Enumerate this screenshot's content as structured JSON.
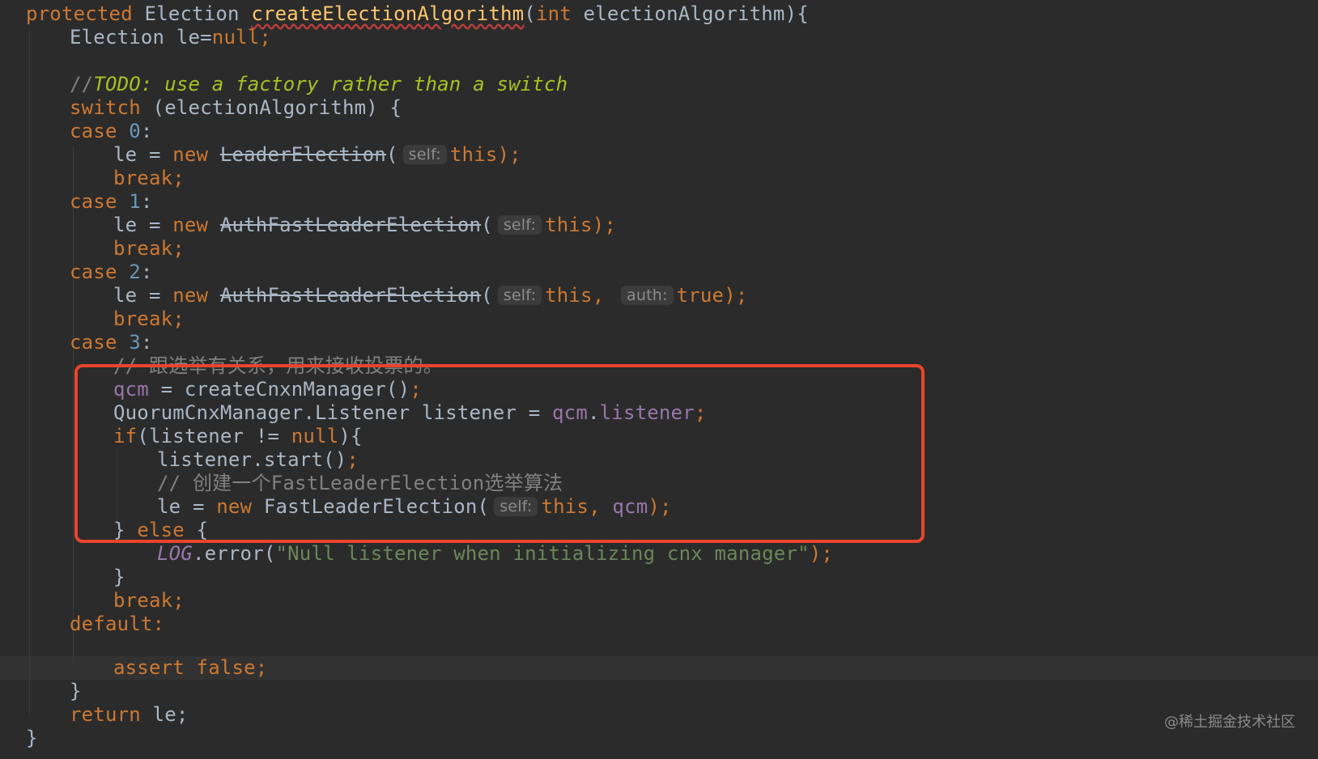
{
  "code": {
    "l1": {
      "a": "protected ",
      "b": "Election ",
      "c": "createElectionAlgorithm",
      "d": "(",
      "e": "int",
      "f": " electionAlgorithm){"
    },
    "l2": {
      "a": "Election le=",
      "b": "null",
      "c": ";"
    },
    "l4": {
      "a": "//",
      "b": "TODO: use a factory rather than a switch"
    },
    "l5": {
      "a": "switch",
      "b": " (electionAlgorithm) {"
    },
    "l6": {
      "a": "case ",
      "b": "0",
      "c": ":"
    },
    "l7": {
      "a": "le = ",
      "b": "new ",
      "c": "LeaderElection",
      "d": "(",
      "hint": "self:",
      "e": "this",
      "f": ");"
    },
    "l8": {
      "a": "break;"
    },
    "l9": {
      "a": "case ",
      "b": "1",
      "c": ":"
    },
    "l10": {
      "a": "le = ",
      "b": "new ",
      "c": "AuthFastLeaderElection",
      "d": "(",
      "hint": "self:",
      "e": "this",
      "f": ");"
    },
    "l11": {
      "a": "break;"
    },
    "l12": {
      "a": "case ",
      "b": "2",
      "c": ":"
    },
    "l13": {
      "a": "le = ",
      "b": "new ",
      "c": "AuthFastLeaderElection",
      "d": "(",
      "hint1": "self:",
      "e": "this",
      "f": ", ",
      "hint2": "auth:",
      "g": "true",
      "h": ");"
    },
    "l14": {
      "a": "break;"
    },
    "l15": {
      "a": "case ",
      "b": "3",
      "c": ":"
    },
    "l16": {
      "a": "// 跟选举有关系，用来接收投票的。"
    },
    "l17": {
      "a": "qcm",
      "b": " = createCnxnManager()",
      "c": ";"
    },
    "l18": {
      "a": "QuorumCnxManager.Listener listener = ",
      "b": "qcm",
      "c": ".",
      "d": "listener",
      "e": ";"
    },
    "l19": {
      "a": "if",
      "b": "(listener != ",
      "c": "null",
      "d": "){"
    },
    "l20": {
      "a": "listener.start()",
      "b": ";"
    },
    "l21": {
      "a": "// 创建一个FastLeaderElection选举算法"
    },
    "l22": {
      "a": "le = ",
      "b": "new ",
      "c": "FastLeaderElection(",
      "hint": "self:",
      "d": "this",
      "e": ", ",
      "f": "qcm",
      "g": ");"
    },
    "l23": {
      "a": "} ",
      "b": "else",
      "c": " {"
    },
    "l24": {
      "a": "LOG",
      "b": ".error(",
      "c": "\"Null listener when initializing cnx manager\"",
      "d": ");"
    },
    "l25": {
      "a": "}"
    },
    "l26": {
      "a": "break;"
    },
    "l27": {
      "a": "default:"
    },
    "l28": {
      "a": "assert ",
      "b": "false;"
    },
    "l29": {
      "a": "}"
    },
    "l30": {
      "a": "return ",
      "b": "le;"
    },
    "l31": {
      "a": "}"
    }
  },
  "watermark": "@稀土掘金技术社区",
  "colors": {
    "background": "#2b2b2b",
    "keyword": "#cc7832",
    "number": "#6897bb",
    "string": "#6a8759",
    "method": "#ffc66d",
    "field": "#9876aa",
    "comment": "#808080",
    "todo": "#a8c023",
    "highlight_box": "#e8452c"
  }
}
